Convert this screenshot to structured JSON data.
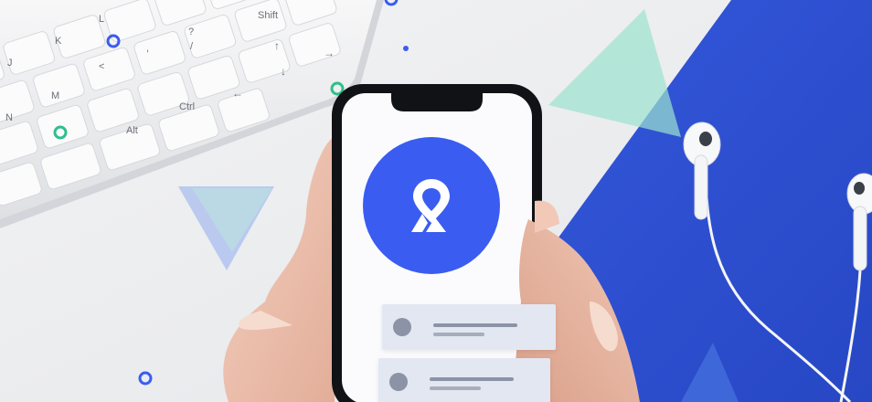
{
  "keyboard": {
    "keys": {
      "shift": "Shift",
      "k": "K",
      "l": "L",
      "j": "J",
      "m": "M",
      "n": "N",
      "alt": "Alt",
      "ctrl": "Ctrl",
      "lt": "<",
      "comma": ",",
      "slash": "/",
      "question": "?"
    }
  },
  "colors": {
    "brand_blue": "#3a5cf0",
    "paper_blue": "#2f53d6",
    "mint": "#9be3cf",
    "card_bg": "#e3e7f1"
  },
  "app": {
    "logo_icon": "location-pin-logo-icon"
  }
}
